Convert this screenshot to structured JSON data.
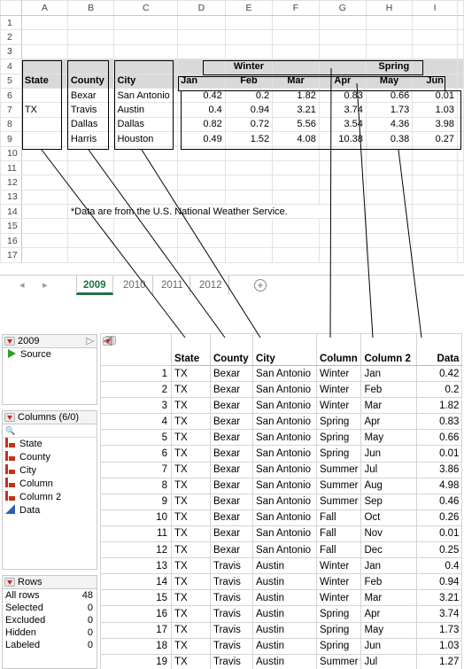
{
  "sheet": {
    "columns": [
      "A",
      "B",
      "C",
      "D",
      "E",
      "F",
      "G",
      "H",
      "I"
    ],
    "row_numbers": [
      "1",
      "2",
      "3",
      "4",
      "5",
      "6",
      "7",
      "8",
      "9",
      "10",
      "11",
      "12",
      "13",
      "14",
      "15",
      "16",
      "17"
    ],
    "season_headers": {
      "winter": "Winter",
      "spring": "Spring"
    },
    "headers": {
      "state": "State",
      "county": "County",
      "city": "City",
      "months": [
        "Jan",
        "Feb",
        "Mar",
        "Apr",
        "May",
        "Jun"
      ]
    },
    "state_value": "TX",
    "rows": [
      {
        "county": "Bexar",
        "city": "San Antonio",
        "values": [
          "0.42",
          "0.2",
          "1.82",
          "0.83",
          "0.66",
          "0.01"
        ]
      },
      {
        "county": "Travis",
        "city": "Austin",
        "values": [
          "0.4",
          "0.94",
          "3.21",
          "3.74",
          "1.73",
          "1.03"
        ]
      },
      {
        "county": "Dallas",
        "city": "Dallas",
        "values": [
          "0.82",
          "0.72",
          "5.56",
          "3.54",
          "4.36",
          "3.98"
        ]
      },
      {
        "county": "Harris",
        "city": "Houston",
        "values": [
          "0.49",
          "1.52",
          "4.08",
          "10.38",
          "0.38",
          "0.27"
        ]
      }
    ],
    "note": "*Data are from the U.S. National Weather Service.",
    "tabs": [
      "2009",
      "2010",
      "2011",
      "2012"
    ],
    "active_tab": "2009",
    "nav": {
      "prev": "◂",
      "next": "▸",
      "add": "+"
    }
  },
  "jmp": {
    "table_panel": {
      "title": "2009",
      "source": "Source"
    },
    "columns_panel": {
      "title": "Columns (6/0)",
      "search_placeholder": "🔍",
      "items": [
        {
          "name": "State",
          "icon": "nominal-icon"
        },
        {
          "name": "County",
          "icon": "nominal-icon"
        },
        {
          "name": "City",
          "icon": "nominal-icon"
        },
        {
          "name": "Column",
          "icon": "nominal-icon"
        },
        {
          "name": "Column 2",
          "icon": "nominal-icon"
        },
        {
          "name": "Data",
          "icon": "continuous-icon"
        }
      ]
    },
    "rows_panel": {
      "title": "Rows",
      "stats": [
        {
          "label": "All rows",
          "value": "48"
        },
        {
          "label": "Selected",
          "value": "0"
        },
        {
          "label": "Excluded",
          "value": "0"
        },
        {
          "label": "Hidden",
          "value": "0"
        },
        {
          "label": "Labeled",
          "value": "0"
        }
      ]
    },
    "grid_headers": [
      "State",
      "County",
      "City",
      "Column",
      "Column 2",
      "Data"
    ],
    "grid_rows": [
      [
        "1",
        "TX",
        "Bexar",
        "San Antonio",
        "Winter",
        "Jan",
        "0.42"
      ],
      [
        "2",
        "TX",
        "Bexar",
        "San Antonio",
        "Winter",
        "Feb",
        "0.2"
      ],
      [
        "3",
        "TX",
        "Bexar",
        "San Antonio",
        "Winter",
        "Mar",
        "1.82"
      ],
      [
        "4",
        "TX",
        "Bexar",
        "San Antonio",
        "Spring",
        "Apr",
        "0.83"
      ],
      [
        "5",
        "TX",
        "Bexar",
        "San Antonio",
        "Spring",
        "May",
        "0.66"
      ],
      [
        "6",
        "TX",
        "Bexar",
        "San Antonio",
        "Spring",
        "Jun",
        "0.01"
      ],
      [
        "7",
        "TX",
        "Bexar",
        "San Antonio",
        "Summer",
        "Jul",
        "3.86"
      ],
      [
        "8",
        "TX",
        "Bexar",
        "San Antonio",
        "Summer",
        "Aug",
        "4.98"
      ],
      [
        "9",
        "TX",
        "Bexar",
        "San Antonio",
        "Summer",
        "Sep",
        "0.46"
      ],
      [
        "10",
        "TX",
        "Bexar",
        "San Antonio",
        "Fall",
        "Oct",
        "0.26"
      ],
      [
        "11",
        "TX",
        "Bexar",
        "San Antonio",
        "Fall",
        "Nov",
        "0.01"
      ],
      [
        "12",
        "TX",
        "Bexar",
        "San Antonio",
        "Fall",
        "Dec",
        "0.25"
      ],
      [
        "13",
        "TX",
        "Travis",
        "Austin",
        "Winter",
        "Jan",
        "0.4"
      ],
      [
        "14",
        "TX",
        "Travis",
        "Austin",
        "Winter",
        "Feb",
        "0.94"
      ],
      [
        "15",
        "TX",
        "Travis",
        "Austin",
        "Winter",
        "Mar",
        "3.21"
      ],
      [
        "16",
        "TX",
        "Travis",
        "Austin",
        "Spring",
        "Apr",
        "3.74"
      ],
      [
        "17",
        "TX",
        "Travis",
        "Austin",
        "Spring",
        "May",
        "1.73"
      ],
      [
        "18",
        "TX",
        "Travis",
        "Austin",
        "Spring",
        "Jun",
        "1.03"
      ],
      [
        "19",
        "TX",
        "Travis",
        "Austin",
        "Summer",
        "Jul",
        "1.27"
      ]
    ]
  }
}
